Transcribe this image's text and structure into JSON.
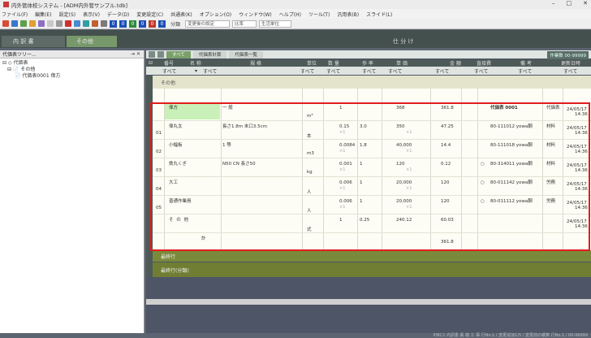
{
  "window": {
    "title": "内外管体校システム - [ADM内外管サンプル.tdb]",
    "min": "–",
    "close": "✕",
    "max": "□"
  },
  "menu": [
    "ファイル(F)",
    "編集(E)",
    "設定(S)",
    "表示(V)",
    "データ(D)",
    "変更設定(C)",
    "共通表(K)",
    "オプション(O)",
    "ウィンドウ(W)",
    "ヘルプ(H)",
    "ツール(T)",
    "汎用表(B)",
    "スライド(L)"
  ],
  "toolbar": {
    "numbers": [
      {
        "v": "0",
        "color": "#1b4fb6"
      },
      {
        "v": "0",
        "color": "#1b4fb6"
      },
      {
        "v": "0",
        "color": "#2f8a3a"
      },
      {
        "v": "0",
        "color": "#1b4fb6"
      },
      {
        "v": "0",
        "color": "#c0392b"
      },
      {
        "v": "0",
        "color": "#1b4fb6"
      }
    ],
    "mode_label": "分類",
    "select1": "変更後の設定",
    "select2": "比率",
    "select3": "生活単位"
  },
  "tabs": {
    "tab1": "内 訳 書",
    "tab2": "その他",
    "tab3": "仕 分 け"
  },
  "sidebar": {
    "title": "代価表ツリー...",
    "pin": "⇥ ✕",
    "tree": [
      {
        "indent": 3,
        "label": "⊟ ◇ 代価表"
      },
      {
        "indent": 9,
        "label": "⊟ 📄 その他"
      },
      {
        "indent": 18,
        "label": "📄 代価表0001 偉方"
      }
    ]
  },
  "filter_tabs": {
    "all": "すべて",
    "calc": "代価表計算",
    "list": "代価表一覧"
  },
  "count_badge": "作業数 00-99999",
  "columns": [
    "番号",
    "名 称",
    "規 格",
    "単位",
    "数 量",
    "歩 率",
    "単 価",
    "金 額",
    "直接費",
    "備 考",
    "更新日時"
  ],
  "filter_label": "すべて",
  "section_top": "その他",
  "rows": [
    {
      "no": "",
      "name": "偉方",
      "spec": "一 般",
      "unit": "m³",
      "qty": "1",
      "rate": "",
      "price": "368",
      "amount": "361.8",
      "mark": "",
      "note": "代価表 0001",
      "tag": "代価表",
      "date": "24/05/17",
      "time": "14:36"
    },
    {
      "no": "01",
      "name": "偉丸太",
      "spec": "長さ1.8m 末口3.5cm",
      "unit": "本",
      "qty": "0.15",
      "rate": "3.0",
      "price": "350",
      "amount": "47.25",
      "mark": "",
      "note": "80-111012 yowa鋼",
      "tag": "材料",
      "date": "24/05/17",
      "time": "14:36"
    },
    {
      "no": "02",
      "name": "小幅板",
      "spec": "1 等",
      "unit": "m3",
      "qty": "0.0084",
      "rate": "1.8",
      "price": "40,000",
      "amount": "14.4",
      "mark": "",
      "note": "80-111018 yowa鋼",
      "tag": "材料",
      "date": "24/05/17",
      "time": "14:36"
    },
    {
      "no": "03",
      "name": "鉄丸くぎ",
      "spec": "N50 CN 長さ50",
      "unit": "kg",
      "qty": "0.001",
      "rate": "1",
      "price": "120",
      "amount": "0.12",
      "mark": "○",
      "note": "80-314011 yowa鋼",
      "tag": "材料",
      "date": "24/05/17",
      "time": "14:36"
    },
    {
      "no": "04",
      "name": "大工",
      "spec": "",
      "unit": "人",
      "qty": "0.006",
      "rate": "1",
      "price": "20,000",
      "amount": "120",
      "mark": "○",
      "note": "80-011142 yowa鋼",
      "tag": "労務",
      "date": "24/05/17",
      "time": "14:36"
    },
    {
      "no": "05",
      "name": "普通作業員",
      "spec": "",
      "unit": "人",
      "qty": "0.006",
      "rate": "1",
      "price": "20,000",
      "amount": "120",
      "mark": "○",
      "note": "80-011112 yowa鋼",
      "tag": "労務",
      "date": "24/05/17",
      "time": "14:36"
    },
    {
      "no": "",
      "name": "そ の 他",
      "spec": "",
      "unit": "式",
      "qty": "1",
      "rate": "0.25",
      "price": "240.12",
      "amount": "60.03",
      "mark": "",
      "note": "",
      "tag": "",
      "date": "24/05/17",
      "time": "14:36"
    }
  ],
  "sub_mark": "×1",
  "total": {
    "label": "計",
    "amount": "361.8"
  },
  "section_bot1": "最終行",
  "section_bot2": "最終行(分類)",
  "status": "P/BC2 内訳書  異 端 工 事  行No.1 / 変更追加1/5 / 変更前の積算  行No.1 / 00-99999"
}
